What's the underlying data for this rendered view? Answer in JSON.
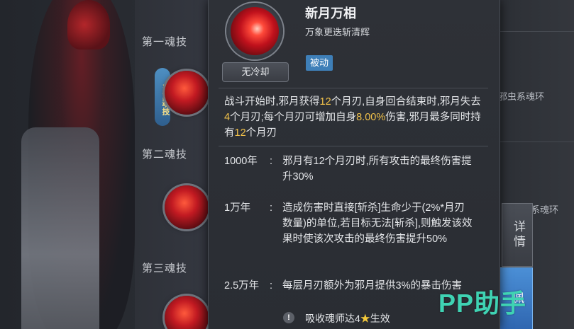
{
  "skill_list": {
    "sections": [
      {
        "title": "第一魂技"
      },
      {
        "title": "第二魂技"
      },
      {
        "title": "第三魂技"
      }
    ],
    "current_badge": "当前魂技"
  },
  "right_panel": {
    "rows": [
      "邪虫系魂环",
      "系魂环"
    ],
    "details_label": "详情",
    "equip_label": "佩"
  },
  "popup": {
    "cooldown": "无冷却",
    "name": "新月万相",
    "subtitle": "万象更迭斩清辉",
    "type": "被动",
    "description": {
      "t1": "战斗开始时,邪月获得",
      "v1": "12",
      "t2": "个月刃,自身回合结束时,邪月失去",
      "v2": "4",
      "t3": "个月刃;每个月刃可增加自身",
      "v3": "8.00%",
      "t4": "伤害,邪月最多同时持有",
      "v4": "12",
      "t5": "个月刃"
    },
    "upgrades": [
      {
        "level": "1000年",
        "effect": "邪月有12个月刃时,所有攻击的最终伤害提升30%"
      },
      {
        "level": "1万年",
        "effect": "造成伤害时直接[斩杀]生命少于(2%*月刃数量)的单位,若目标无法[斩杀],则触发该效果时使该次攻击的最终伤害提升50%"
      },
      {
        "level": "2.5万年",
        "effect": "每层月刃额外为邪月提供3%的暴击伤害"
      }
    ],
    "footer": {
      "warning_icon": "!",
      "text_before": "吸收魂师达4",
      "star": "★",
      "text_after": "生效"
    }
  },
  "watermark": "PP助手",
  "colors": {
    "highlight": "#f2c24a",
    "type_tag": "#3e7fb8",
    "equip_button": "#2f66b0",
    "watermark": "#3fd3b3"
  }
}
